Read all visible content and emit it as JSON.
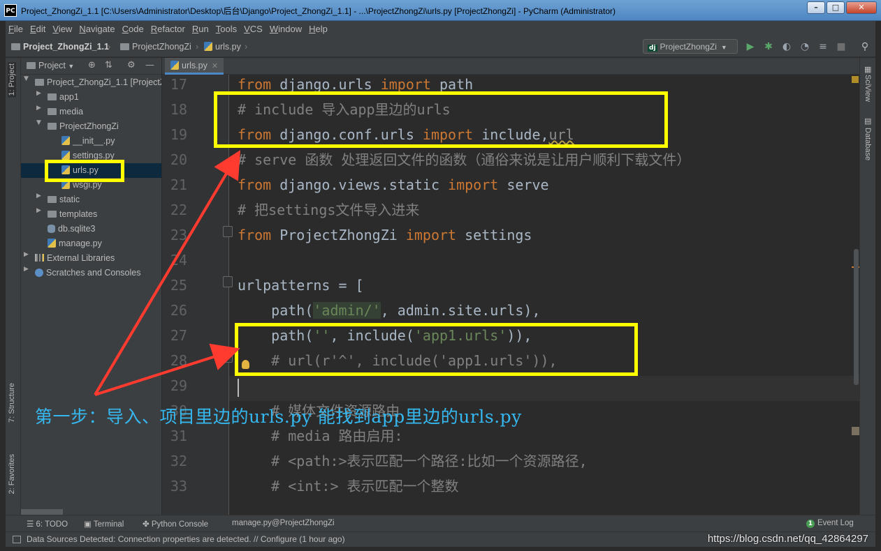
{
  "window": {
    "title": "Project_ZhongZi_1.1 [C:\\Users\\Administrator\\Desktop\\后台\\Django\\Project_ZhongZi_1.1] - ...\\ProjectZhongZi\\urls.py [ProjectZhongZi] - PyCharm (Administrator)",
    "app_icon": "PC",
    "controls": {
      "minimize": "–",
      "maximize": "□",
      "close": "✕"
    }
  },
  "menu": [
    "File",
    "Edit",
    "View",
    "Navigate",
    "Code",
    "Refactor",
    "Run",
    "Tools",
    "VCS",
    "Window",
    "Help"
  ],
  "breadcrumb": {
    "project": "Project_ZhongZi_1.1",
    "folder": "ProjectZhongZi",
    "file": "urls.py"
  },
  "run_config": {
    "badge": "dj",
    "label": "ProjectZhongZi"
  },
  "toolbar_icons": [
    "run-icon",
    "debug-icon",
    "coverage-icon",
    "profile-icon",
    "concurrency-icon",
    "stop-icon",
    "search-icon"
  ],
  "left_strip": {
    "project": "1: Project",
    "structure": "7: Structure",
    "favorites": "2: Favorites"
  },
  "right_strip": {
    "sciview": "SciView",
    "database": "Database"
  },
  "project_panel": {
    "header": "Project",
    "tree": [
      {
        "label": "Project_ZhongZi_1.1 [ProjectZhongZi]",
        "type": "folder",
        "expanded": true
      },
      {
        "label": "app1",
        "type": "folder",
        "expanded": false
      },
      {
        "label": "media",
        "type": "folder",
        "expanded": false
      },
      {
        "label": "ProjectZhongZi",
        "type": "folder",
        "expanded": true
      },
      {
        "label": "__init__.py",
        "type": "py"
      },
      {
        "label": "settings.py",
        "type": "py"
      },
      {
        "label": "urls.py",
        "type": "py",
        "selected": true
      },
      {
        "label": "wsgi.py",
        "type": "py"
      },
      {
        "label": "static",
        "type": "folder",
        "expanded": false
      },
      {
        "label": "templates",
        "type": "folder",
        "expanded": false
      },
      {
        "label": "db.sqlite3",
        "type": "db"
      },
      {
        "label": "manage.py",
        "type": "py"
      },
      {
        "label": "External Libraries",
        "type": "lib"
      },
      {
        "label": "Scratches and Consoles",
        "type": "scratch"
      }
    ]
  },
  "editor": {
    "tab": "urls.py",
    "line_numbers": [
      "17",
      "18",
      "19",
      "20",
      "21",
      "22",
      "23",
      "24",
      "25",
      "26",
      "27",
      "28",
      "29",
      "30",
      "31",
      "32",
      "33"
    ]
  },
  "code": {
    "l17": [
      "from",
      " django.urls ",
      "import",
      " path"
    ],
    "l18": "# include 导入app里边的urls",
    "l19": [
      "from",
      " django.conf.urls ",
      "import",
      " include,",
      "url"
    ],
    "l20": "# serve 函数 处理返回文件的函数（通俗来说是让用户顺利下载文件）",
    "l21": [
      "from",
      " django.views.static ",
      "import",
      " serve"
    ],
    "l22": "# 把settings文件导入进来",
    "l23": [
      "from",
      " ProjectZhongZi ",
      "import",
      " settings"
    ],
    "l25": "urlpatterns = [",
    "l26": [
      "    path(",
      "'admin/'",
      ", admin.site.urls),"
    ],
    "l27": [
      "    path(",
      "''",
      ", include(",
      "'app1.urls'",
      ")),"
    ],
    "l28": "    # url(r'^', include('app1.urls')),",
    "l30": "    # 媒体文件资源路由",
    "l31": "    # media 路由启用:",
    "l32": "    # <path:>表示匹配一个路径:比如一个资源路径,",
    "l33": "    # <int:> 表示匹配一个整数"
  },
  "annotation": {
    "text": "第一步：导入、项目里边的urls.py 能找到app里边的urls.py",
    "highlight_color": "#ffff00",
    "arrow_color": "#ff3b30",
    "text_color": "#35b8f0"
  },
  "bottom_tools": [
    "6: TODO",
    "Terminal",
    "Python Console",
    "manage.py@ProjectZhongZi"
  ],
  "event_log": {
    "count": "1",
    "label": "Event Log"
  },
  "status_bar": {
    "message": "Data Sources Detected: Connection properties are detected. // Configure (1 hour ago)",
    "watermark": "https://blog.csdn.net/qq_42864297"
  },
  "colors": {
    "background": "#2b2b2b",
    "keyword": "#cc7832",
    "comment": "#808080",
    "string": "#6a8759",
    "text": "#a9b7c6"
  }
}
